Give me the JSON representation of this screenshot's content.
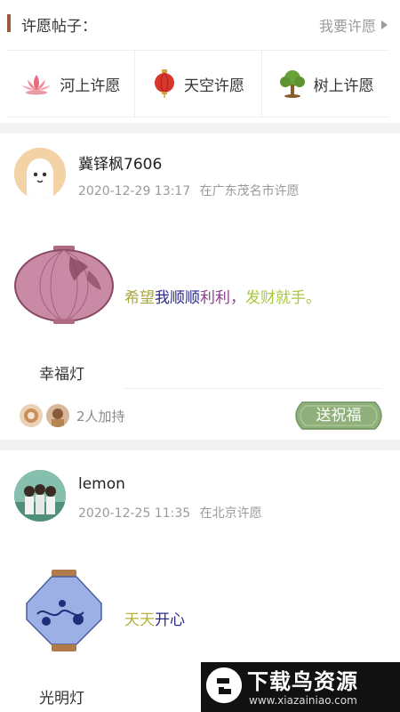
{
  "header": {
    "title": "许愿帖子：",
    "link_label": "我要许愿"
  },
  "categories": [
    {
      "label": "河上许愿",
      "icon": "lotus-icon"
    },
    {
      "label": "天空许愿",
      "icon": "sky-lantern-icon"
    },
    {
      "label": "树上许愿",
      "icon": "tree-icon"
    }
  ],
  "posts": [
    {
      "username": "冀铎枫7606",
      "datetime": "2020-12-29 13:17",
      "location": "在广东茂名市许愿",
      "wish_parts": [
        "希望",
        "我顺顺",
        "利利，",
        "发财就手。"
      ],
      "wish_colors": [
        "#a8a83c",
        "#2d2b8a",
        "#8a3f8a",
        "#a8c83c"
      ],
      "lamp_name": "幸福灯",
      "support_count": "2人加持",
      "bless_label": "送祝福"
    },
    {
      "username": "lemon",
      "datetime": "2020-12-25 11:35",
      "location": "在北京许愿",
      "wish_parts": [
        "天天",
        "开心"
      ],
      "wish_colors": [
        "#b9b13a",
        "#2d2b8a"
      ],
      "lamp_name": "光明灯"
    }
  ],
  "watermark": {
    "title": "下载鸟资源",
    "url": "www.xiazainiao.com"
  },
  "colors": {
    "accent_bar": "#9b5a3c",
    "bless_button": "#8fb07a"
  }
}
